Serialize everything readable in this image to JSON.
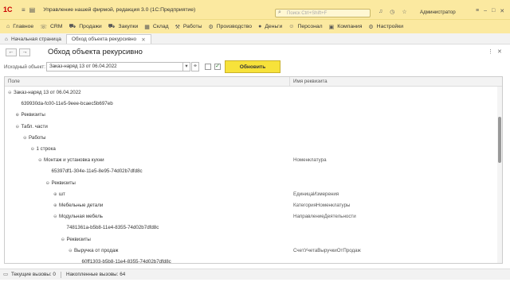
{
  "titlebar": {
    "logo": "1С",
    "title": "Управление нашей фирмой, редакция 3.0  (1С:Предприятие)",
    "search_placeholder": "Поиск Ctrl+Shift+F",
    "user": "Администратор"
  },
  "main_menu": [
    {
      "label": "Главное",
      "icon": "home-icon"
    },
    {
      "label": "CRM",
      "icon": "phone-icon"
    },
    {
      "label": "Продажи",
      "icon": "cart-icon"
    },
    {
      "label": "Закупки",
      "icon": "truck-icon"
    },
    {
      "label": "Склад",
      "icon": "warehouse-icon"
    },
    {
      "label": "Работы",
      "icon": "wrench-icon"
    },
    {
      "label": "Производство",
      "icon": "factory-icon"
    },
    {
      "label": "Деньги",
      "icon": "money-icon"
    },
    {
      "label": "Персонал",
      "icon": "person-icon"
    },
    {
      "label": "Компания",
      "icon": "company-icon"
    },
    {
      "label": "Настройки",
      "icon": "gear-icon"
    }
  ],
  "tabs": {
    "home": "Начальная страница",
    "current": "Обход объекта рекурсивно"
  },
  "form": {
    "title": "Обход объекта рекурсивно",
    "source_label": "Исходный объект:",
    "source_value": "Заказ-наряд 13 от 06.04.2022",
    "refresh_label": "Обновить"
  },
  "table": {
    "headers": {
      "field": "Поле",
      "attr": "Имя реквизита"
    },
    "rows": [
      {
        "text": "Заказ-наряд 13 от 06.04.2022",
        "attr": "",
        "indent": 0,
        "expander": "⊖"
      },
      {
        "text": "639930da-fc00-11e5-9eee-bcaec5b697eb",
        "attr": "",
        "indent": 1,
        "expander": ""
      },
      {
        "text": "Реквизиты",
        "attr": "",
        "indent": 1,
        "expander": "⊕"
      },
      {
        "text": "Табл. части",
        "attr": "",
        "indent": 1,
        "expander": "⊖"
      },
      {
        "text": "Работы",
        "attr": "",
        "indent": 2,
        "expander": "⊖"
      },
      {
        "text": "1 строка",
        "attr": "",
        "indent": 3,
        "expander": "⊖"
      },
      {
        "text": "Монтаж и установка кухни",
        "attr": "Номенклатура",
        "indent": 4,
        "expander": "⊖"
      },
      {
        "text": "65397df1-304e-11e5-8e95-74d02b7dfd8c",
        "attr": "",
        "indent": 5,
        "expander": ""
      },
      {
        "text": "Реквизиты",
        "attr": "",
        "indent": 5,
        "expander": "⊖"
      },
      {
        "text": "шт",
        "attr": "ЕдиницаИзмерения",
        "indent": 6,
        "expander": "⊕"
      },
      {
        "text": "Мебельные детали",
        "attr": "КатегорияНоменклатуры",
        "indent": 6,
        "expander": "⊕"
      },
      {
        "text": "Модульная мебель",
        "attr": "НаправлениеДеятельности",
        "indent": 6,
        "expander": "⊖"
      },
      {
        "text": "7481361a-b5b8-11e4-8355-74d02b7dfd8c",
        "attr": "",
        "indent": 7,
        "expander": ""
      },
      {
        "text": "Реквизиты",
        "attr": "",
        "indent": 7,
        "expander": "⊖"
      },
      {
        "text": "Выручка от продаж",
        "attr": "СчетУчетаВыручкиОтПродаж",
        "indent": 8,
        "expander": "⊖"
      },
      {
        "text": "60ff1303-b5b8-11e4-8355-74d02b7dfd8c",
        "attr": "",
        "indent": 9,
        "expander": ""
      }
    ]
  },
  "statusbar": {
    "current_calls": "Текущие вызовы: 0",
    "accumulated_calls": "Накопленные вызовы: 64"
  }
}
